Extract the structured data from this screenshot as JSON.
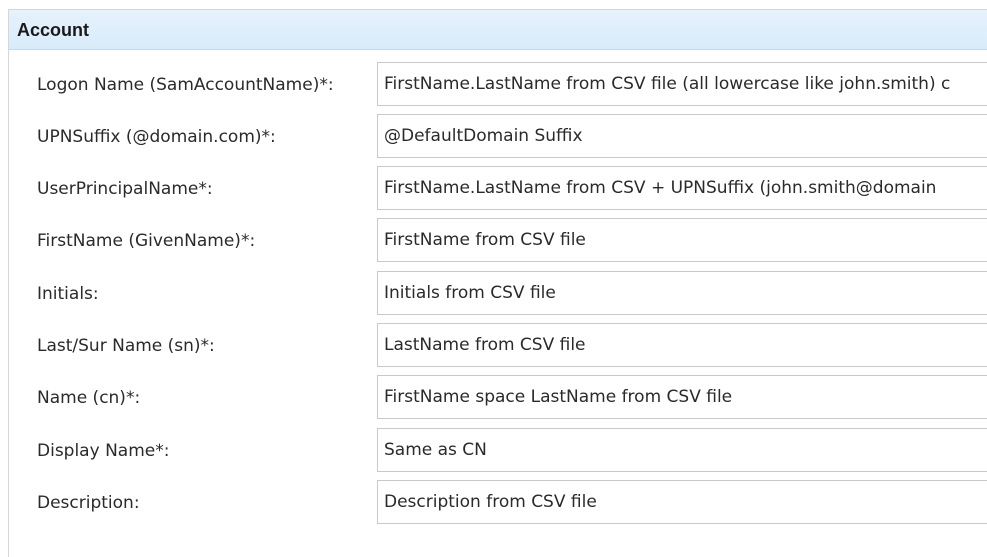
{
  "section": {
    "title": "Account"
  },
  "fields": [
    {
      "label": "Logon Name (SamAccountName)*:",
      "value": "FirstName.LastName from CSV file (all lowercase like john.smith) c"
    },
    {
      "label": "UPNSuffix (@domain.com)*:",
      "value": "@DefaultDomain Suffix"
    },
    {
      "label": "UserPrincipalName*:",
      "value": "FirstName.LastName from CSV + UPNSuffix (john.smith@domain"
    },
    {
      "label": "FirstName (GivenName)*:",
      "value": "FirstName from CSV file"
    },
    {
      "label": "Initials:",
      "value": "Initials from CSV file"
    },
    {
      "label": "Last/Sur Name (sn)*:",
      "value": "LastName from CSV file"
    },
    {
      "label": "Name (cn)*:",
      "value": "FirstName space LastName from CSV file"
    },
    {
      "label": "Display Name*:",
      "value": "Same as CN"
    },
    {
      "label": "Description:",
      "value": "Description from CSV file"
    }
  ]
}
